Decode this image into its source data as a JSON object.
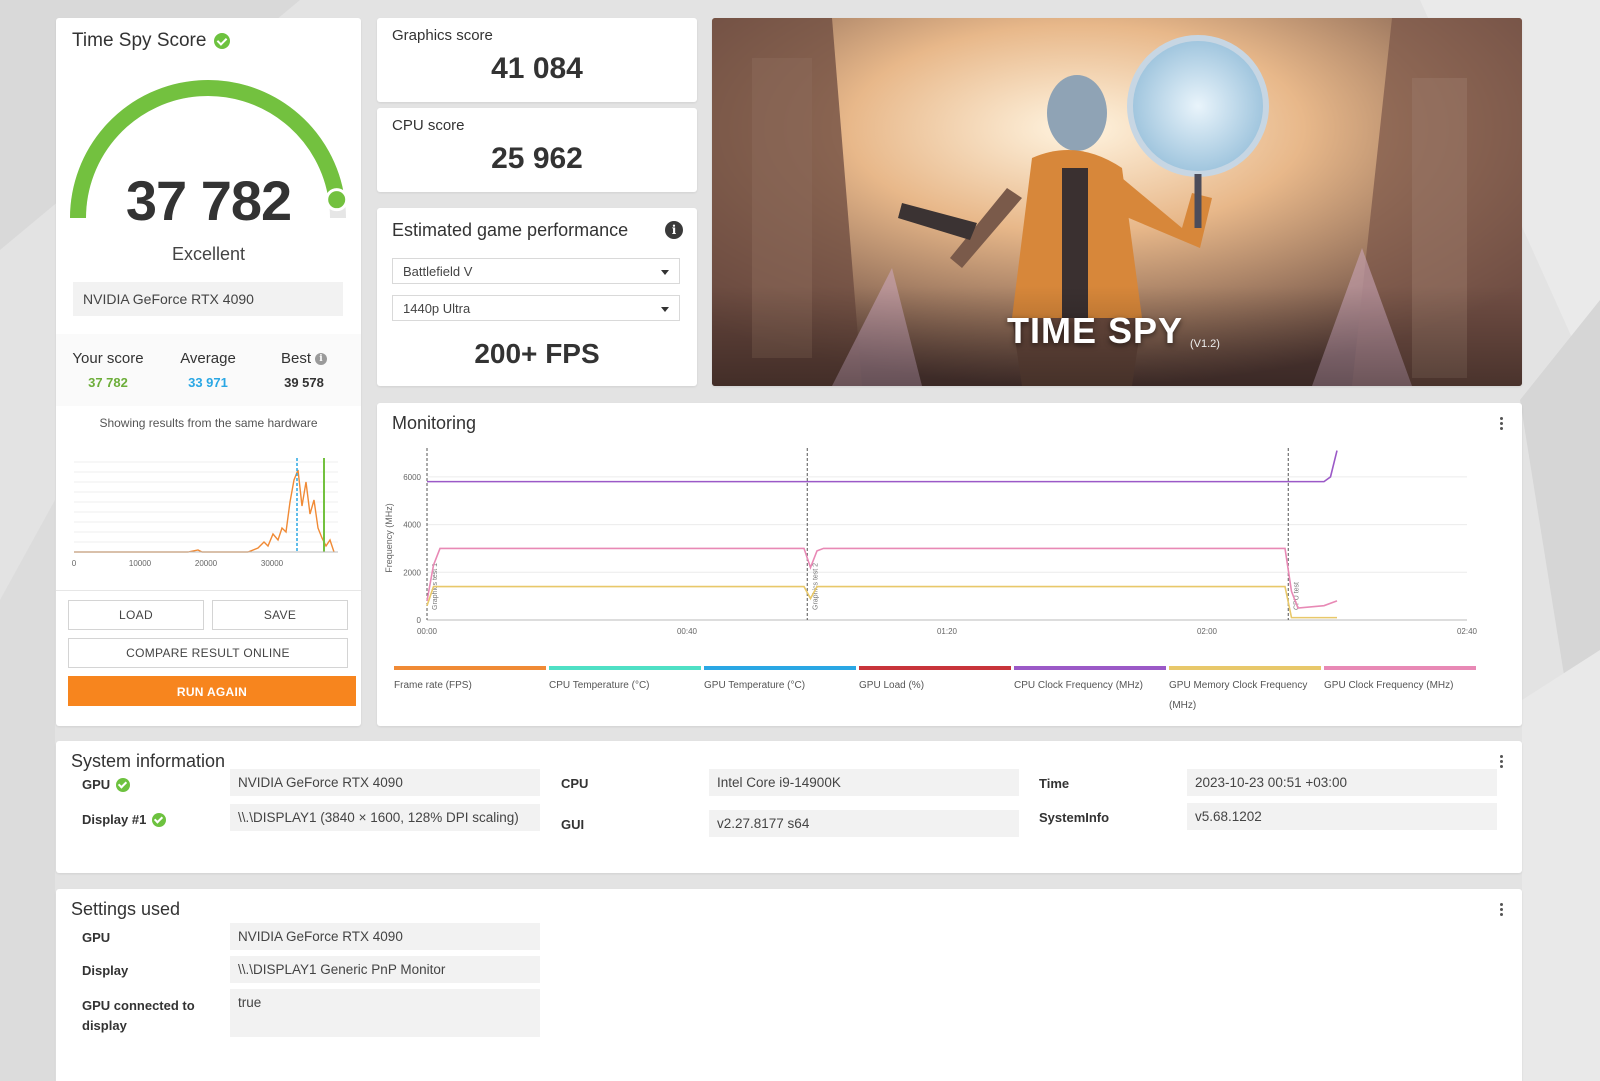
{
  "score_card": {
    "title": "Time Spy Score",
    "score": "37 782",
    "rating": "Excellent",
    "hardware": "NVIDIA GeForce RTX 4090",
    "your_score_label": "Your score",
    "your_score": "37 782",
    "average_label": "Average",
    "average": "33 971",
    "best_label": "Best",
    "best": "39 578",
    "showing_text": "Showing results from the same hardware",
    "gauge_fraction": 0.955,
    "histogram_ticks": [
      "0",
      "10000",
      "20000",
      "30000"
    ],
    "load_label": "LOAD",
    "save_label": "SAVE",
    "compare_label": "COMPARE RESULT ONLINE",
    "run_again_label": "RUN AGAIN"
  },
  "graphics_score": {
    "label": "Graphics score",
    "value": "41 084"
  },
  "cpu_score": {
    "label": "CPU score",
    "value": "25 962"
  },
  "game_perf": {
    "title": "Estimated game performance",
    "game": "Battlefield V",
    "preset": "1440p Ultra",
    "fps": "200+ FPS"
  },
  "hero": {
    "title": "TIME SPY",
    "version": "(V1.2)"
  },
  "monitoring": {
    "title": "Monitoring",
    "y_label": "Frequency (MHz)",
    "y_ticks": [
      "0",
      "2000",
      "4000",
      "6000"
    ],
    "x_ticks": [
      "00:00",
      "00:40",
      "01:20",
      "02:00",
      "02:40"
    ],
    "markers": [
      "Graphics test 1",
      "Graphics test 2",
      "CPU test"
    ],
    "legend": [
      {
        "label": "Frame rate (FPS)",
        "color": "#f08a35"
      },
      {
        "label": "CPU Temperature (°C)",
        "color": "#4fe0c5"
      },
      {
        "label": "GPU Temperature (°C)",
        "color": "#2aa7e4"
      },
      {
        "label": "GPU Load (%)",
        "color": "#c8343a"
      },
      {
        "label": "CPU Clock Frequency (MHz)",
        "color": "#9b59c7"
      },
      {
        "label": "GPU Memory Clock Frequency (MHz)",
        "color": "#e8c86a"
      },
      {
        "label": "GPU Clock Frequency (MHz)",
        "color": "#e889b5"
      }
    ]
  },
  "system_info": {
    "title": "System information",
    "gpu_label": "GPU",
    "gpu": "NVIDIA GeForce RTX 4090",
    "display_label": "Display #1",
    "display": "\\\\.\\DISPLAY1 (3840 × 1600, 128% DPI scaling)",
    "cpu_label": "CPU",
    "cpu": "Intel Core i9-14900K",
    "gui_label": "GUI",
    "gui": "v2.27.8177 s64",
    "time_label": "Time",
    "time": "2023-10-23 00:51 +03:00",
    "sysinfo_label": "SystemInfo",
    "sysinfo": "v5.68.1202"
  },
  "settings": {
    "title": "Settings used",
    "gpu_label": "GPU",
    "gpu": "NVIDIA GeForce RTX 4090",
    "display_label": "Display",
    "display": "\\\\.\\DISPLAY1 Generic PnP Monitor",
    "connected_label": "GPU connected to display",
    "connected": "true"
  }
}
